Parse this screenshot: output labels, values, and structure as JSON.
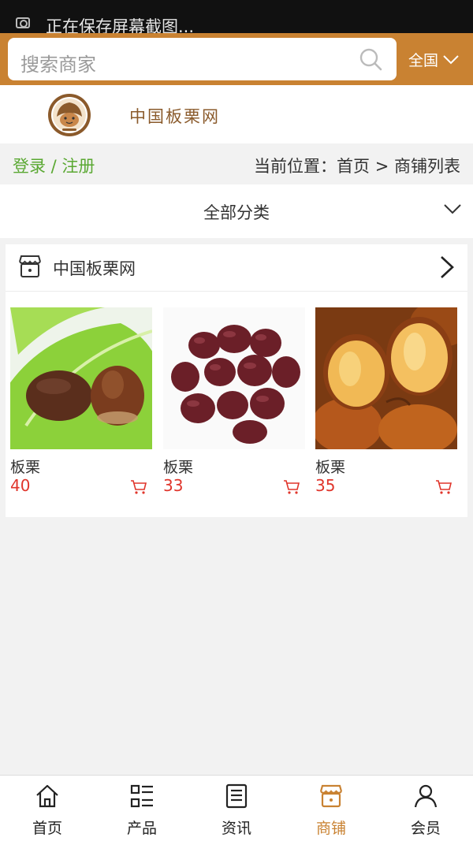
{
  "status_bar": {
    "message": "正在保存屏幕截图..."
  },
  "search": {
    "placeholder": "搜索商家",
    "region": "全国"
  },
  "brand": {
    "name": "中国板栗网"
  },
  "auth": {
    "login_register": "登录 / 注册"
  },
  "breadcrumb": {
    "text": "当前位置：首页 > 商铺列表"
  },
  "category": {
    "label": "全部分类"
  },
  "shop": {
    "name": "中国板栗网",
    "products": [
      {
        "name": "板栗",
        "price": "40"
      },
      {
        "name": "板栗",
        "price": "33"
      },
      {
        "name": "板栗",
        "price": "35"
      }
    ]
  },
  "tabs": [
    {
      "label": "首页",
      "icon": "home-icon"
    },
    {
      "label": "产品",
      "icon": "grid-list-icon"
    },
    {
      "label": "资讯",
      "icon": "news-icon"
    },
    {
      "label": "商铺",
      "icon": "shop-icon",
      "active": true
    },
    {
      "label": "会员",
      "icon": "user-icon"
    }
  ],
  "colors": {
    "accent": "#c98232",
    "price": "#e0352b",
    "login": "#5aa832"
  }
}
